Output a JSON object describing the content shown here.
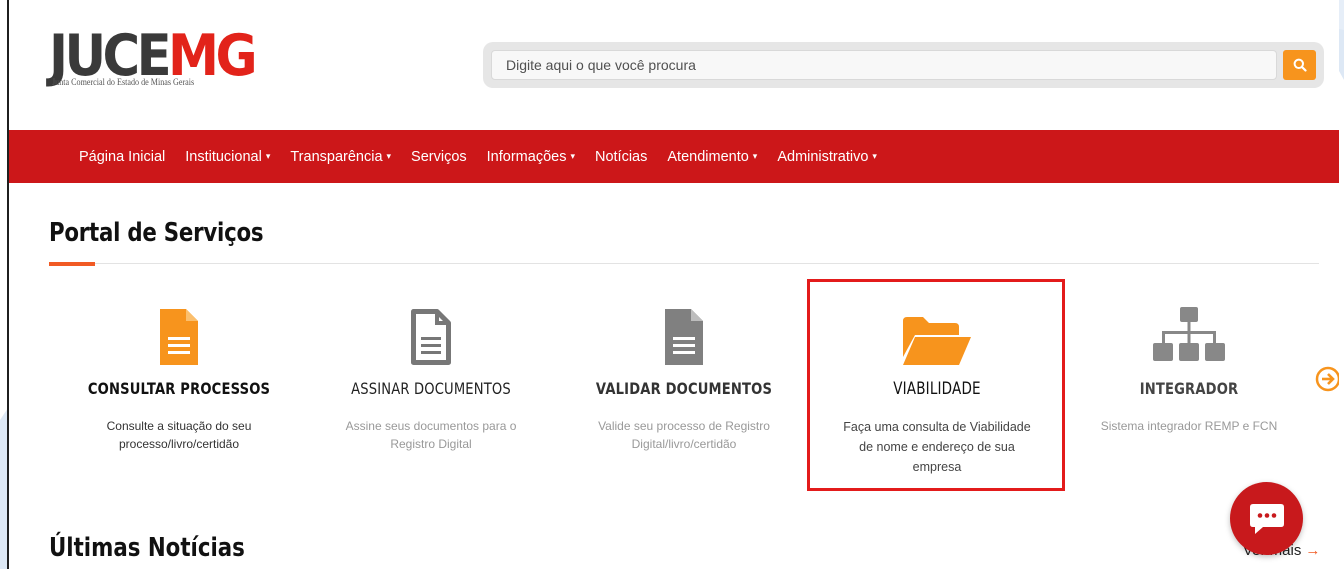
{
  "logo": {
    "text_a": "JUCE",
    "text_b": "MG",
    "subtitle": "Junta Comercial do Estado de Minas Gerais"
  },
  "search": {
    "placeholder": "Digite aqui o que você procura",
    "value": ""
  },
  "nav": {
    "items": [
      {
        "label": "Página Inicial",
        "has_dropdown": false
      },
      {
        "label": "Institucional",
        "has_dropdown": true
      },
      {
        "label": "Transparência",
        "has_dropdown": true
      },
      {
        "label": "Serviços",
        "has_dropdown": false
      },
      {
        "label": "Informações",
        "has_dropdown": true
      },
      {
        "label": "Notícias",
        "has_dropdown": false
      },
      {
        "label": "Atendimento",
        "has_dropdown": true
      },
      {
        "label": "Administrativo",
        "has_dropdown": true
      }
    ],
    "caret": "▾"
  },
  "portal": {
    "title": "Portal de Serviços",
    "cards": [
      {
        "title": "CONSULTAR PROCESSOS",
        "description": "Consulte a situação do seu processo/livro/certidão",
        "icon": "file-lines-icon"
      },
      {
        "title": "ASSINAR DOCUMENTOS",
        "description": "Assine seus documentos para o Registro Digital",
        "icon": "file-outline-icon"
      },
      {
        "title": "VALIDAR DOCUMENTOS",
        "description": "Valide seu processo de Registro Digital/livro/certidão",
        "icon": "file-lines-icon"
      },
      {
        "title": "VIABILIDADE",
        "description": "Faça uma consulta de Viabilidade de nome e endereço de sua empresa",
        "icon": "folder-open-icon"
      },
      {
        "title": "INTEGRADOR",
        "description": "Sistema integrador REMP e FCN",
        "icon": "sitemap-icon"
      }
    ]
  },
  "news": {
    "title": "Últimas Notícias",
    "see_all_label": "Ver mais",
    "see_all_arrow": "→"
  },
  "colors": {
    "brand_red": "#cc1719",
    "accent_orange": "#f7941d",
    "highlight_red": "#e31b1b",
    "icon_gray": "#777777",
    "text_dark": "#111111",
    "background_stripe": "#dde8f5"
  }
}
